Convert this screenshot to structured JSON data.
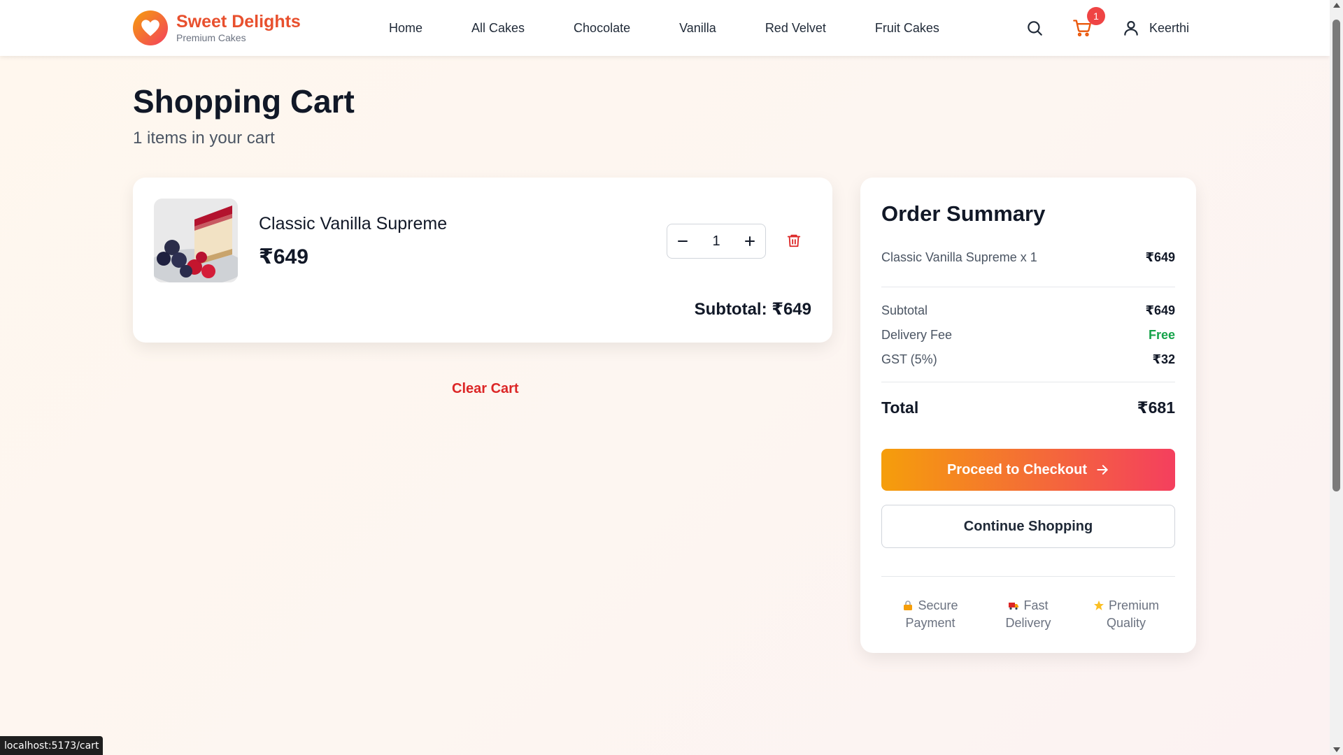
{
  "brand": {
    "name": "Sweet Delights",
    "tagline": "Premium Cakes"
  },
  "nav": {
    "links": [
      "Home",
      "All Cakes",
      "Chocolate",
      "Vanilla",
      "Red Velvet",
      "Fruit Cakes"
    ],
    "cart_count": "1",
    "user_name": "Keerthi"
  },
  "page": {
    "title": "Shopping Cart",
    "subtitle": "1 items in your cart"
  },
  "cart": {
    "items": [
      {
        "name": "Classic Vanilla Supreme",
        "price": "₹649",
        "quantity": "1",
        "subtotal": "Subtotal: ₹649"
      }
    ],
    "clear_label": "Clear Cart"
  },
  "summary": {
    "title": "Order Summary",
    "line_item_label": "Classic Vanilla Supreme x 1",
    "line_item_value": "₹649",
    "subtotal_label": "Subtotal",
    "subtotal_value": "₹649",
    "delivery_label": "Delivery Fee",
    "delivery_value": "Free",
    "gst_label": "GST (5%)",
    "gst_value": "₹32",
    "total_label": "Total",
    "total_value": "₹681",
    "checkout_label": "Proceed to Checkout",
    "continue_label": "Continue Shopping",
    "features": [
      {
        "icon": "lock-icon",
        "line1": "Secure",
        "line2": "Payment"
      },
      {
        "icon": "truck-icon",
        "line1": "Fast",
        "line2": "Delivery"
      },
      {
        "icon": "star-icon",
        "line1": "Premium",
        "line2": "Quality"
      }
    ]
  },
  "status_bar": {
    "url": "localhost:5173/cart"
  },
  "colors": {
    "brand": "#e8502e",
    "accent_start": "#f59e0b",
    "accent_end": "#f43f5e",
    "danger": "#dc2626",
    "success": "#16a34a"
  }
}
